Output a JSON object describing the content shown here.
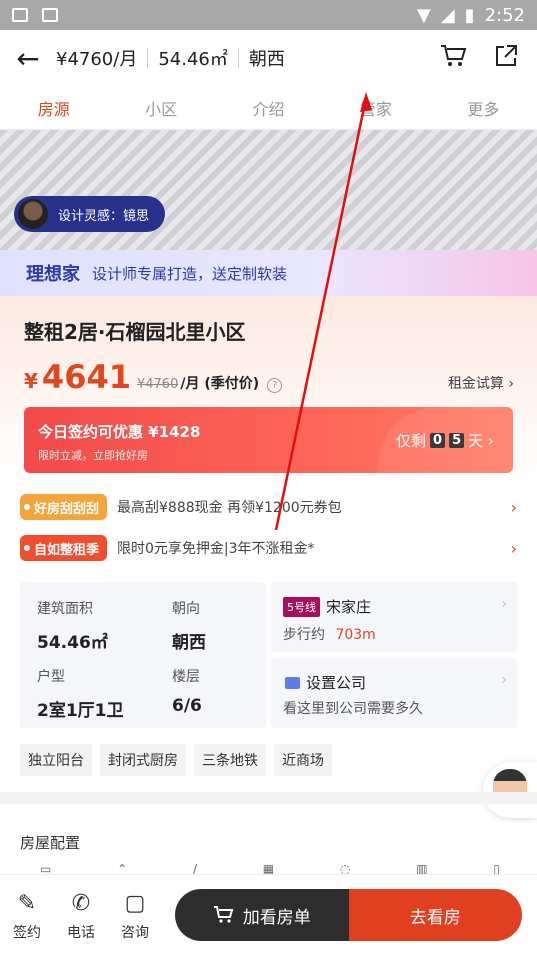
{
  "statusbar": {
    "time": "2:52"
  },
  "header": {
    "price": "¥4760/月",
    "area": "54.46㎡",
    "orientation": "朝西"
  },
  "tabs": [
    {
      "label": "房源"
    },
    {
      "label": "小区"
    },
    {
      "label": "介绍"
    },
    {
      "label": "管家"
    },
    {
      "label": "更多"
    }
  ],
  "hero": {
    "designer_label": "设计灵感：镜思"
  },
  "banner": {
    "brand": "理想家",
    "slogan": "设计师专属打造，送定制软装"
  },
  "listing": {
    "title": "整租2居·石榴园北里小区",
    "currency": "¥",
    "price": "4641",
    "original_price": "¥4760",
    "unit": "/月 (季付价)",
    "info_icon": "?",
    "calc_link": "租金试算 ›"
  },
  "promo": {
    "title": "今日签约可优惠 ¥1428",
    "subtitle": "限时立减，立即抢好房",
    "remain_prefix": "仅剩",
    "digit1": "0",
    "digit2": "5",
    "remain_suffix": "天 ›"
  },
  "offers": [
    {
      "badge": "好房刮刮刮",
      "text": "最高刮¥888现金 再领¥1200元券包",
      "color": "#f3a43a"
    },
    {
      "badge": "自如整租季",
      "text": "限时0元享免押金|3年不涨租金*",
      "color": "#ef4d2e"
    }
  ],
  "details": {
    "area_label": "建筑面积",
    "area_value": "54.46㎡",
    "orientation_label": "朝向",
    "orientation_value": "朝西",
    "layout_label": "户型",
    "layout_value": "2室1厅1卫",
    "floor_label": "楼层",
    "floor_value": "6/6"
  },
  "metro": {
    "line": "5号线",
    "station": "宋家庄",
    "walk_prefix": "步行约",
    "walk_distance": "703m"
  },
  "company": {
    "title": "设置公司",
    "desc": "看这里到公司需要多久"
  },
  "features": [
    "独立阳台",
    "封闭式厨房",
    "三条地铁",
    "近商场"
  ],
  "config": {
    "title": "房屋配置"
  },
  "bottom": {
    "sign": "签约",
    "phone": "电话",
    "consult": "咨询",
    "add_cart": "加看房单",
    "visit": "去看房"
  }
}
